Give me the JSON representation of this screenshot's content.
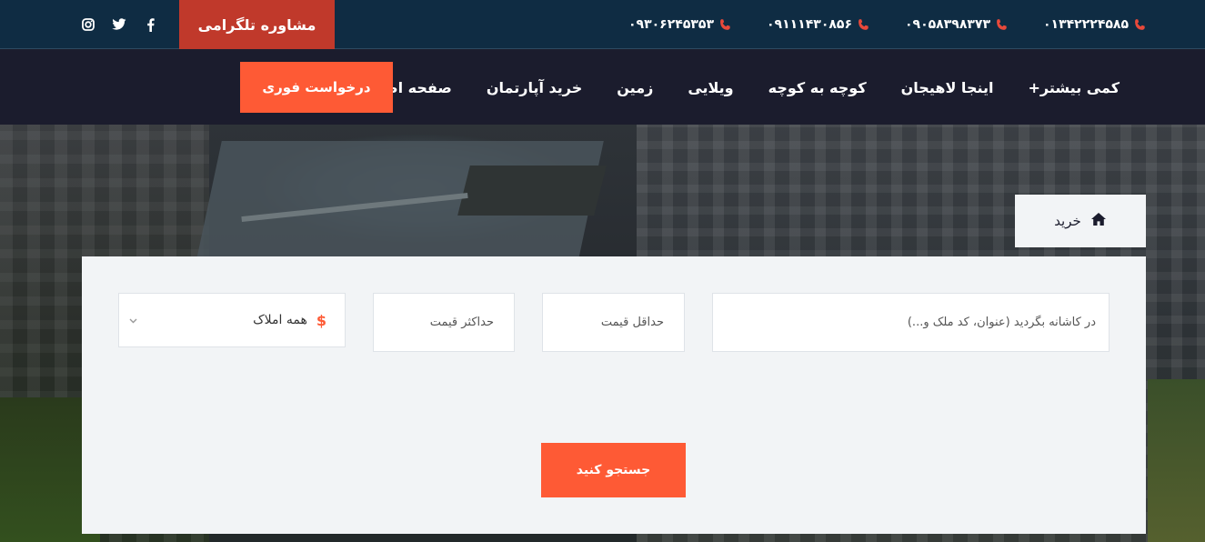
{
  "topbar": {
    "telegram_label": "مشاوره تلگرامی",
    "phones": [
      "۰۱۳۴۲۲۲۴۵۸۵",
      "۰۹۰۵۸۳۹۸۳۷۳",
      "۰۹۱۱۱۴۳۰۸۵۶",
      "۰۹۳۰۶۲۴۵۳۵۳"
    ],
    "social_icons": [
      "facebook-icon",
      "twitter-icon",
      "instagram-icon"
    ]
  },
  "nav": {
    "items": [
      "صفحه اصلی",
      "خرید آپارتمان",
      "زمین",
      "ویلایی",
      "کوچه به کوچه",
      "اینجا لاهیجان",
      "کمی بیشتر+"
    ],
    "cta_label": "درخواست فوری"
  },
  "breadcrumb": {
    "icon": "home-icon",
    "label": "خرید"
  },
  "search": {
    "keyword_placeholder": "در کاشانه بگردید (عنوان، کد ملک و...)",
    "min_price_placeholder": "حداقل قیمت",
    "max_price_placeholder": "حداکثر قیمت",
    "type_selected": "همه املاک",
    "type_icon_text": "$",
    "submit_label": "جستجو کنید"
  },
  "colors": {
    "topbar_bg": "#0f2c43",
    "nav_bg": "#1b1c2d",
    "accent": "#fe5a35",
    "telegram_bg": "#c0392b",
    "panel_bg": "#f2f4f6"
  }
}
